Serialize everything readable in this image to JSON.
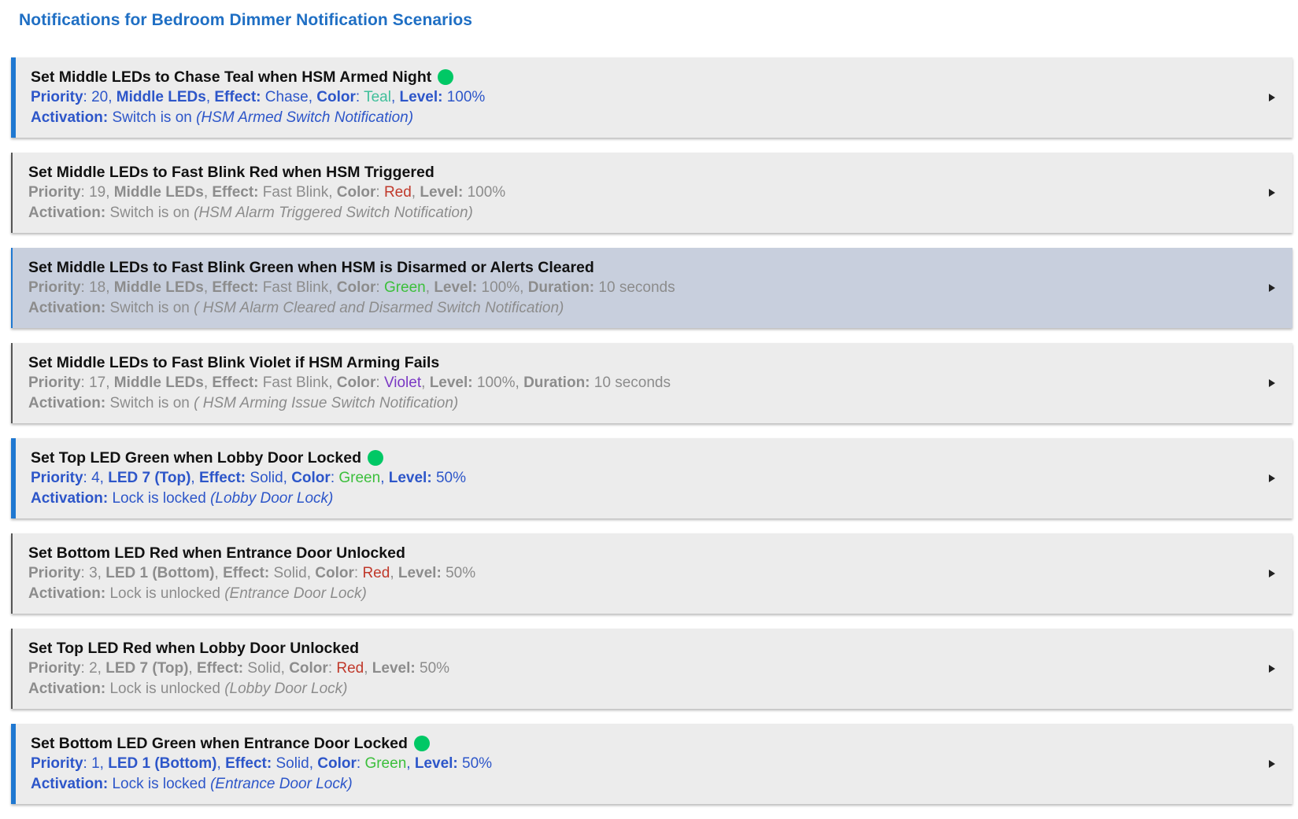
{
  "page_title": "Notifications for Bedroom Dimmer Notification Scenarios",
  "colors": {
    "Teal": "#3fbf9a",
    "Red": "#c0392b",
    "Green": "#3cbf3c",
    "Violet": "#7a38c4",
    "active_dot": "#00c865",
    "active_text": "#2d56c9",
    "inactive_text": "#8c8c8c"
  },
  "labels": {
    "priority": "Priority",
    "effect": "Effect:",
    "color": "Color",
    "level": "Level:",
    "duration": "Duration:",
    "activation": "Activation:"
  },
  "notifications": [
    {
      "title": "Set Middle LEDs to Chase Teal when HSM Armed Night",
      "active": true,
      "highlighted": false,
      "status_icon": "green-dot-icon",
      "priority": "20",
      "leds": "Middle LEDs",
      "effect": "Chase",
      "color": "Teal",
      "level": "100%",
      "duration": "",
      "activation": "Switch is on",
      "source": "(HSM Armed Switch Notification)"
    },
    {
      "title": "Set Middle LEDs to Fast Blink Red when HSM Triggered",
      "active": false,
      "highlighted": false,
      "status_icon": "",
      "priority": "19",
      "leds": "Middle LEDs",
      "effect": "Fast Blink",
      "color": "Red",
      "level": "100%",
      "duration": "",
      "activation": "Switch is on",
      "source": "(HSM Alarm Triggered Switch Notification)"
    },
    {
      "title": "Set Middle LEDs to Fast Blink Green when HSM is Disarmed or Alerts Cleared",
      "active": false,
      "highlighted": true,
      "status_icon": "",
      "priority": "18",
      "leds": "Middle LEDs",
      "effect": "Fast Blink",
      "color": "Green",
      "level": "100%",
      "duration": "10 seconds",
      "activation": "Switch is on",
      "source": "( HSM Alarm Cleared and Disarmed Switch Notification)"
    },
    {
      "title": "Set Middle LEDs to Fast Blink Violet if HSM Arming Fails",
      "active": false,
      "highlighted": false,
      "status_icon": "",
      "priority": "17",
      "leds": "Middle LEDs",
      "effect": "Fast Blink",
      "color": "Violet",
      "level": "100%",
      "duration": "10 seconds",
      "activation": "Switch is on",
      "source": "( HSM Arming Issue Switch Notification)"
    },
    {
      "title": "Set Top LED Green when Lobby Door Locked",
      "active": true,
      "highlighted": false,
      "status_icon": "green-dot-icon",
      "priority": "4",
      "leds": "LED 7 (Top)",
      "effect": "Solid",
      "color": "Green",
      "level": "50%",
      "duration": "",
      "activation": "Lock is locked",
      "source": "(Lobby Door Lock)"
    },
    {
      "title": "Set Bottom LED Red when Entrance Door Unlocked",
      "active": false,
      "highlighted": false,
      "status_icon": "",
      "priority": "3",
      "leds": "LED 1 (Bottom)",
      "effect": "Solid",
      "color": "Red",
      "level": "50%",
      "duration": "",
      "activation": "Lock is unlocked",
      "source": "(Entrance Door Lock)"
    },
    {
      "title": "Set Top LED Red when Lobby Door Unlocked",
      "active": false,
      "highlighted": false,
      "status_icon": "",
      "priority": "2",
      "leds": "LED 7 (Top)",
      "effect": "Solid",
      "color": "Red",
      "level": "50%",
      "duration": "",
      "activation": "Lock is unlocked",
      "source": "(Lobby Door Lock)"
    },
    {
      "title": "Set Bottom LED Green when Entrance Door Locked",
      "active": true,
      "highlighted": false,
      "status_icon": "green-dot-icon",
      "priority": "1",
      "leds": "LED 1 (Bottom)",
      "effect": "Solid",
      "color": "Green",
      "level": "50%",
      "duration": "",
      "activation": "Lock is locked",
      "source": "(Entrance Door Lock)"
    }
  ]
}
